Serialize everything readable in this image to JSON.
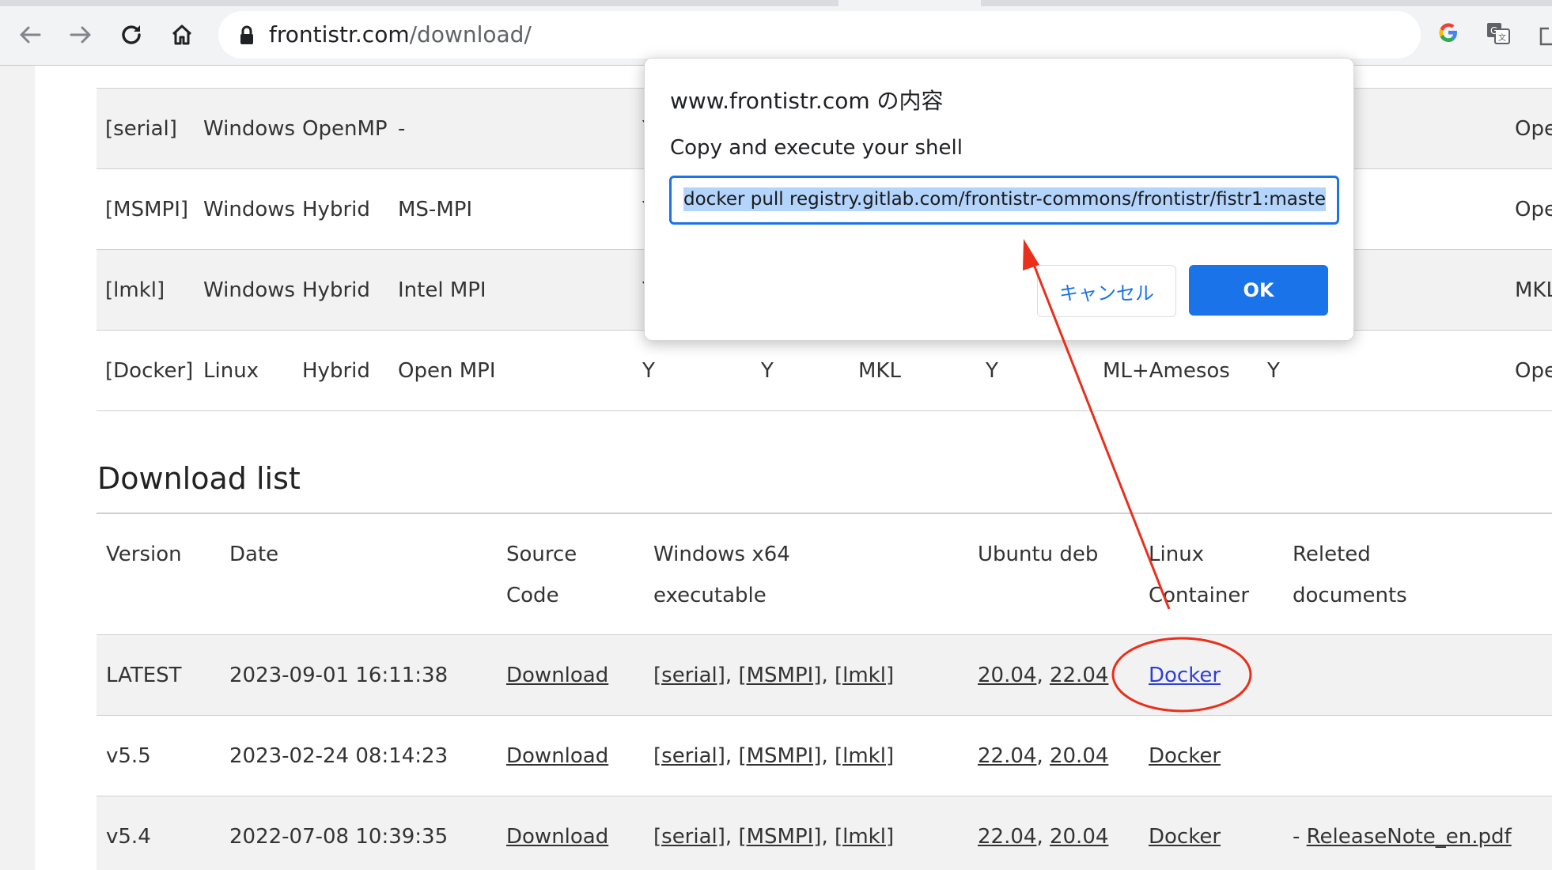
{
  "browser": {
    "url_host": "frontistr.com",
    "url_path": "/download/"
  },
  "build_table": {
    "rows": [
      {
        "name": "[serial]",
        "os": "Windows",
        "parallel": "OpenMP",
        "mpi": "-",
        "c5": "Y",
        "c6": "",
        "c7": "",
        "c8": "",
        "c9": "",
        "c10": "",
        "c11": "OpenBLAS"
      },
      {
        "name": "[MSMPI]",
        "os": "Windows",
        "parallel": "Hybrid",
        "mpi": "MS-MPI",
        "c5": "Y",
        "c6": "",
        "c7": "",
        "c8": "",
        "c9": "",
        "c10": "",
        "c11": "OpenBLAS"
      },
      {
        "name": "[lmkl]",
        "os": "Windows",
        "parallel": "Hybrid",
        "mpi": "Intel MPI",
        "c5": "Y",
        "c6": "",
        "c7": "",
        "c8": "",
        "c9": "",
        "c10": "",
        "c11": "MKL"
      },
      {
        "name": "[Docker]",
        "os": "Linux",
        "parallel": "Hybrid",
        "mpi": "Open MPI",
        "c5": "Y",
        "c6": "Y",
        "c7": "MKL",
        "c8": "Y",
        "c9": "ML+Amesos",
        "c10": "Y",
        "c11": "OpenBLAS"
      }
    ]
  },
  "download_list": {
    "heading": "Download list",
    "headers": {
      "version": "Version",
      "date": "Date",
      "source_1": "Source",
      "source_2": "Code",
      "windows_1": "Windows x64",
      "windows_2": "executable",
      "ubuntu": "Ubuntu deb",
      "linux_1": "Linux",
      "linux_2": "Container",
      "related_1": "Releted",
      "related_2": "documents"
    },
    "rows": [
      {
        "version": "LATEST",
        "date": "2023-09-01 16:11:38",
        "source": "Download",
        "win_serial": "[serial]",
        "win_msmpi": "[MSMPI]",
        "win_lmkl": "[lmkl]",
        "sep": ",",
        "deb_a": "20.04",
        "deb_b": "22.04",
        "container": "Docker",
        "doc_prefix": "",
        "doc": ""
      },
      {
        "version": "v5.5",
        "date": "2023-02-24 08:14:23",
        "source": "Download",
        "win_serial": "[serial]",
        "win_msmpi": "[MSMPI]",
        "win_lmkl": "[lmkl]",
        "sep": ",",
        "deb_a": "22.04",
        "deb_b": "20.04",
        "container": "Docker",
        "doc_prefix": "",
        "doc": ""
      },
      {
        "version": "v5.4",
        "date": "2022-07-08 10:39:35",
        "source": "Download",
        "win_serial": "[serial]",
        "win_msmpi": "[MSMPI]",
        "win_lmkl": "[lmkl]",
        "sep": ",",
        "deb_a": "22.04",
        "deb_b": "20.04",
        "container": "Docker",
        "doc_prefix": "- ",
        "doc": "ReleaseNote_en.pdf"
      }
    ]
  },
  "dialog": {
    "title": "www.frontistr.com の内容",
    "message": "Copy and execute your shell",
    "value": "docker pull registry.gitlab.com/frontistr-commons/frontistr/fistr1:maste",
    "cancel_label": "キャンセル",
    "ok_label": "OK"
  },
  "colors": {
    "accent": "#1a73e8",
    "annotation": "#e8301c",
    "visited_link": "#2e3fd9"
  }
}
